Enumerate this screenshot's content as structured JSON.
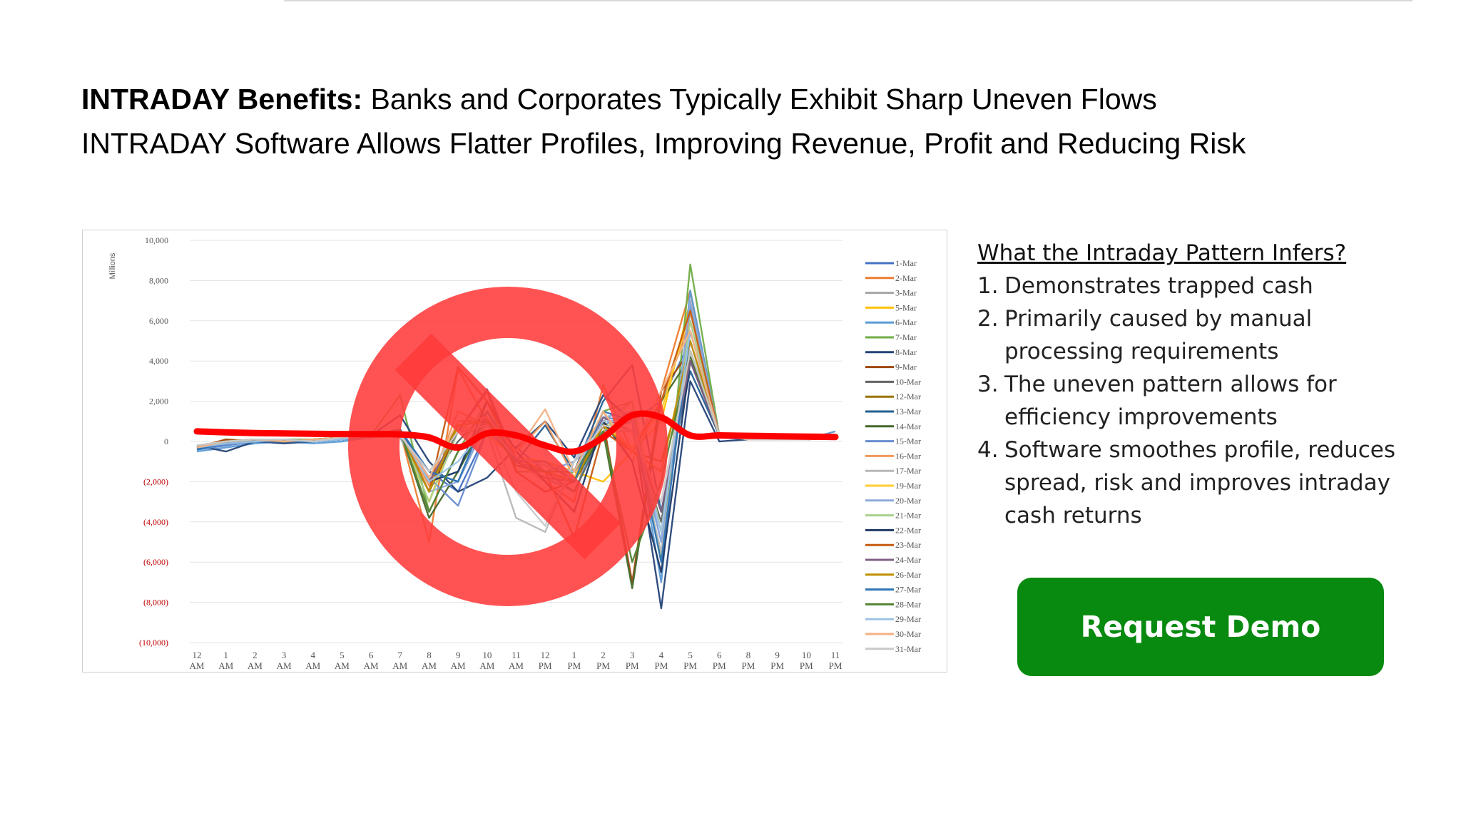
{
  "headline": {
    "bold": "INTRADAY Benefits:",
    "line1_rest": " Banks and Corporates Typically Exhibit Sharp Uneven Flows",
    "line2": "INTRADAY Software Allows Flatter Profiles, Improving Revenue, Profit and Reducing Risk"
  },
  "infer": {
    "title": "What the Intraday Pattern Infers?",
    "items": [
      {
        "num": "1.",
        "text": "Demonstrates trapped cash"
      },
      {
        "num": "2.",
        "text": "Primarily caused by manual processing requirements"
      },
      {
        "num": "3.",
        "text": "The uneven pattern allows for efficiency improvements"
      },
      {
        "num": "4.",
        "text": "Software smoothes profile, reduces spread, risk and improves intraday cash returns"
      }
    ]
  },
  "cta": {
    "label": "Request Demo"
  },
  "colors": {
    "cta": "#078a0f",
    "no_symbol": "#ff3b3b",
    "flat_line": "#ff0000",
    "negative_ticks": "#c00000"
  },
  "chart_data": {
    "type": "line",
    "ylabel": "Millions",
    "ylim": [
      -10000,
      10000
    ],
    "y_ticks": [
      {
        "v": 10000,
        "label": "10,000"
      },
      {
        "v": 8000,
        "label": "8,000"
      },
      {
        "v": 6000,
        "label": "6,000"
      },
      {
        "v": 4000,
        "label": "4,000"
      },
      {
        "v": 2000,
        "label": "2,000"
      },
      {
        "v": 0,
        "label": "0"
      },
      {
        "v": -2000,
        "label": "(2,000)"
      },
      {
        "v": -4000,
        "label": "(4,000)"
      },
      {
        "v": -6000,
        "label": "(6,000)"
      },
      {
        "v": -8000,
        "label": "(8,000)"
      },
      {
        "v": -10000,
        "label": "(10,000)"
      }
    ],
    "categories": [
      [
        "12",
        "AM"
      ],
      [
        "1",
        "AM"
      ],
      [
        "2",
        "AM"
      ],
      [
        "3",
        "AM"
      ],
      [
        "4",
        "AM"
      ],
      [
        "5",
        "AM"
      ],
      [
        "6",
        "AM"
      ],
      [
        "7",
        "AM"
      ],
      [
        "8",
        "AM"
      ],
      [
        "9",
        "AM"
      ],
      [
        "10",
        "AM"
      ],
      [
        "11",
        "AM"
      ],
      [
        "12",
        "PM"
      ],
      [
        "1",
        "PM"
      ],
      [
        "2",
        "PM"
      ],
      [
        "3",
        "PM"
      ],
      [
        "4",
        "PM"
      ],
      [
        "5",
        "PM"
      ],
      [
        "6",
        "PM"
      ],
      [
        "8",
        "PM"
      ],
      [
        "9",
        "PM"
      ],
      [
        "10",
        "PM"
      ],
      [
        "11",
        "PM"
      ]
    ],
    "grid": true,
    "legend": "right",
    "series": [
      {
        "name": "1-Mar",
        "color": "#4472c4",
        "values": [
          -400,
          -200,
          100,
          0,
          100,
          100,
          200,
          600,
          -1500,
          -2500,
          500,
          -300,
          -1500,
          -1000,
          500,
          1000,
          2000,
          5000,
          200,
          100,
          100,
          100,
          200
        ]
      },
      {
        "name": "2-Mar",
        "color": "#ed7d31",
        "values": [
          -300,
          0,
          0,
          100,
          0,
          200,
          300,
          500,
          -5000,
          3600,
          1000,
          -500,
          -2000,
          -3000,
          2800,
          -500,
          2500,
          7500,
          300,
          100,
          100,
          100,
          200
        ]
      },
      {
        "name": "3-Mar",
        "color": "#a5a5a5",
        "values": [
          -200,
          0,
          100,
          0,
          100,
          200,
          300,
          200,
          -2500,
          500,
          800,
          -1000,
          -1500,
          -2000,
          1000,
          2000,
          -6000,
          6500,
          300,
          100,
          100,
          100,
          200
        ]
      },
      {
        "name": "5-Mar",
        "color": "#ffc000",
        "values": [
          -300,
          100,
          0,
          100,
          0,
          100,
          300,
          400,
          -3000,
          800,
          300,
          -800,
          -1000,
          -1500,
          -2000,
          -500,
          1000,
          7000,
          300,
          100,
          100,
          100,
          200
        ]
      },
      {
        "name": "6-Mar",
        "color": "#5b9bd5",
        "values": [
          -500,
          -300,
          -100,
          0,
          -100,
          0,
          200,
          300,
          -2000,
          -1500,
          1500,
          -1000,
          -1800,
          -2500,
          800,
          1500,
          -7000,
          7500,
          300,
          100,
          100,
          100,
          500
        ]
      },
      {
        "name": "7-Mar",
        "color": "#70ad47",
        "values": [
          -300,
          0,
          100,
          100,
          100,
          200,
          300,
          2300,
          -3500,
          -500,
          2000,
          -1500,
          -1500,
          -2000,
          1500,
          2000,
          -6000,
          8800,
          300,
          100,
          100,
          100,
          200
        ]
      },
      {
        "name": "8-Mar",
        "color": "#264478",
        "values": [
          -200,
          -500,
          0,
          -100,
          0,
          100,
          300,
          1300,
          -1000,
          -2500,
          -1800,
          -300,
          1000,
          -800,
          2300,
          1000,
          -8300,
          3000,
          0,
          100,
          100,
          100,
          200
        ]
      },
      {
        "name": "9-Mar",
        "color": "#9e480e",
        "values": [
          -300,
          100,
          0,
          100,
          0,
          200,
          300,
          500,
          -2500,
          500,
          2500,
          -1500,
          -2500,
          -2000,
          1000,
          -7000,
          2500,
          4500,
          300,
          100,
          100,
          100,
          200
        ]
      },
      {
        "name": "10-Mar",
        "color": "#636363",
        "values": [
          -300,
          0,
          100,
          0,
          100,
          200,
          300,
          600,
          -2000,
          0,
          1500,
          -1000,
          -1500,
          -2500,
          500,
          500,
          -4000,
          4500,
          300,
          100,
          100,
          100,
          200
        ]
      },
      {
        "name": "12-Mar",
        "color": "#997300",
        "values": [
          -300,
          0,
          100,
          0,
          100,
          200,
          300,
          500,
          -2500,
          1000,
          1000,
          -800,
          -1500,
          -2000,
          1000,
          -500,
          -1000,
          4000,
          300,
          100,
          100,
          100,
          200
        ]
      },
      {
        "name": "13-Mar",
        "color": "#255e91",
        "values": [
          -400,
          -200,
          0,
          100,
          0,
          100,
          300,
          500,
          -1500,
          -2000,
          1000,
          -1000,
          800,
          -1500,
          2000,
          3800,
          -3500,
          3500,
          300,
          100,
          100,
          100,
          200
        ]
      },
      {
        "name": "14-Mar",
        "color": "#43682b",
        "values": [
          -300,
          0,
          100,
          0,
          100,
          200,
          300,
          500,
          -3800,
          -1500,
          1200,
          -1200,
          -1500,
          -2000,
          500,
          -7300,
          2000,
          4200,
          300,
          100,
          100,
          100,
          200
        ]
      },
      {
        "name": "15-Mar",
        "color": "#698ed0",
        "values": [
          -400,
          -200,
          0,
          0,
          0,
          100,
          300,
          500,
          -1800,
          -3200,
          500,
          -800,
          -1200,
          -1500,
          1200,
          1000,
          -5000,
          6800,
          300,
          100,
          100,
          100,
          200
        ]
      },
      {
        "name": "16-Mar",
        "color": "#f1975a",
        "values": [
          -300,
          0,
          100,
          0,
          100,
          200,
          300,
          400,
          -2200,
          1500,
          800,
          -500,
          1000,
          -1800,
          1500,
          -1000,
          2000,
          6000,
          300,
          100,
          100,
          100,
          200
        ]
      },
      {
        "name": "17-Mar",
        "color": "#b7b7b7",
        "values": [
          -200,
          0,
          100,
          100,
          0,
          200,
          300,
          300,
          -1500,
          500,
          500,
          -3800,
          -4500,
          -1000,
          500,
          500,
          -5500,
          5000,
          300,
          100,
          100,
          100,
          200
        ]
      },
      {
        "name": "19-Mar",
        "color": "#ffcd33",
        "values": [
          -300,
          0,
          0,
          100,
          0,
          200,
          300,
          400,
          -2000,
          500,
          800,
          -800,
          -1200,
          -1800,
          800,
          -300,
          1500,
          6500,
          300,
          100,
          100,
          100,
          200
        ]
      },
      {
        "name": "20-Mar",
        "color": "#8faadc",
        "values": [
          -300,
          -100,
          0,
          100,
          0,
          100,
          300,
          300,
          -2500,
          -2000,
          1000,
          -1000,
          -1500,
          -1000,
          1200,
          1500,
          -5000,
          7000,
          300,
          100,
          100,
          100,
          200
        ]
      },
      {
        "name": "21-Mar",
        "color": "#a9d18e",
        "values": [
          -300,
          0,
          100,
          0,
          100,
          200,
          300,
          500,
          -3000,
          500,
          1500,
          -1000,
          -2000,
          -1500,
          500,
          2000,
          -4500,
          6000,
          300,
          100,
          100,
          100,
          200
        ]
      },
      {
        "name": "22-Mar",
        "color": "#1f3864",
        "values": [
          -400,
          0,
          0,
          100,
          0,
          100,
          300,
          500,
          -2000,
          -1500,
          2000,
          -500,
          -2000,
          -3500,
          1000,
          -1000,
          -6500,
          4000,
          300,
          100,
          100,
          100,
          200
        ]
      },
      {
        "name": "23-Mar",
        "color": "#c55a11",
        "values": [
          -300,
          0,
          100,
          0,
          100,
          200,
          300,
          500,
          -2500,
          3700,
          2000,
          -800,
          -1500,
          -4800,
          500,
          -500,
          2000,
          6500,
          300,
          100,
          100,
          100,
          200
        ]
      },
      {
        "name": "24-Mar",
        "color": "#7f6084",
        "values": [
          -300,
          0,
          100,
          0,
          100,
          200,
          300,
          500,
          -2000,
          500,
          2600,
          -1000,
          -1800,
          -2000,
          1200,
          500,
          -3500,
          4000,
          300,
          100,
          100,
          100,
          200
        ]
      },
      {
        "name": "26-Mar",
        "color": "#bf8f00",
        "values": [
          -300,
          0,
          0,
          100,
          0,
          200,
          300,
          400,
          -2500,
          800,
          1000,
          -800,
          -1500,
          -2000,
          800,
          -500,
          -1500,
          5000,
          300,
          100,
          100,
          100,
          200
        ]
      },
      {
        "name": "27-Mar",
        "color": "#2e75b6",
        "values": [
          -400,
          -100,
          0,
          0,
          0,
          100,
          300,
          500,
          -1500,
          -2000,
          1500,
          -1000,
          -1000,
          -2000,
          1500,
          1000,
          -6000,
          5500,
          300,
          100,
          100,
          100,
          200
        ]
      },
      {
        "name": "28-Mar",
        "color": "#548235",
        "values": [
          -300,
          0,
          100,
          0,
          100,
          200,
          300,
          500,
          -3500,
          -500,
          1000,
          -1200,
          -1500,
          -1500,
          500,
          -6000,
          -2000,
          4500,
          300,
          100,
          100,
          100,
          200
        ]
      },
      {
        "name": "29-Mar",
        "color": "#9dc3e6",
        "values": [
          -300,
          -100,
          0,
          100,
          0,
          100,
          300,
          400,
          -2000,
          -1000,
          800,
          -800,
          -1200,
          -1500,
          1000,
          1000,
          -4500,
          5500,
          300,
          100,
          100,
          100,
          200
        ]
      },
      {
        "name": "30-Mar",
        "color": "#f4b183",
        "values": [
          -300,
          0,
          100,
          0,
          100,
          200,
          300,
          400,
          -1800,
          1000,
          1200,
          -500,
          1600,
          -1500,
          1500,
          -500,
          2500,
          5500,
          300,
          100,
          100,
          100,
          200
        ]
      },
      {
        "name": "31-Mar",
        "color": "#c9c9c9",
        "values": [
          -200,
          0,
          100,
          100,
          0,
          200,
          300,
          300,
          -1500,
          500,
          800,
          -2500,
          -4200,
          -1000,
          800,
          500,
          -3000,
          4500,
          300,
          100,
          100,
          100,
          200
        ]
      }
    ],
    "overlay": {
      "flat_line_values": [
        500,
        450,
        420,
        400,
        380,
        370,
        360,
        350,
        200,
        -300,
        400,
        300,
        -200,
        -500,
        200,
        1300,
        1200,
        300,
        300,
        280,
        260,
        240,
        220
      ]
    }
  }
}
